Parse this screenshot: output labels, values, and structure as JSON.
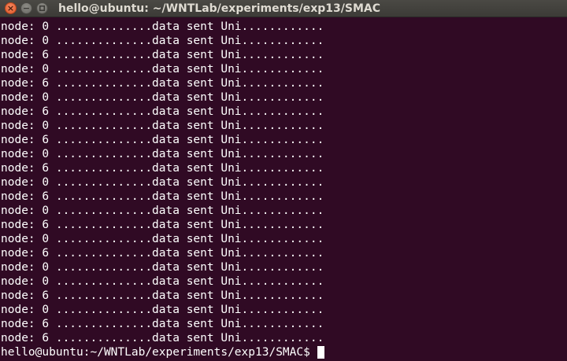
{
  "window": {
    "title": "hello@ubuntu: ~/WNTLab/experiments/exp13/SMAC",
    "buttons": {
      "close": "×",
      "minimize": "−"
    }
  },
  "terminal": {
    "lines": [
      "node: 0 ..............data sent Uni............",
      "node: 0 ..............data sent Uni............",
      "node: 6 ..............data sent Uni............",
      "node: 0 ..............data sent Uni............",
      "node: 6 ..............data sent Uni............",
      "node: 0 ..............data sent Uni............",
      "node: 6 ..............data sent Uni............",
      "node: 0 ..............data sent Uni............",
      "node: 6 ..............data sent Uni............",
      "node: 0 ..............data sent Uni............",
      "node: 6 ..............data sent Uni............",
      "node: 0 ..............data sent Uni............",
      "node: 6 ..............data sent Uni............",
      "node: 0 ..............data sent Uni............",
      "node: 6 ..............data sent Uni............",
      "node: 0 ..............data sent Uni............",
      "node: 6 ..............data sent Uni............",
      "node: 0 ..............data sent Uni............",
      "node: 0 ..............data sent Uni............",
      "node: 6 ..............data sent Uni............",
      "node: 0 ..............data sent Uni............",
      "node: 6 ..............data sent Uni............",
      "node: 6 ..............data sent Uni............"
    ],
    "prompt": "hello@ubuntu:~/WNTLab/experiments/exp13/SMAC$"
  },
  "colors": {
    "terminal_background": "#300a24",
    "terminal_text": "#ffffff",
    "titlebar_background": "#3c3b37",
    "close_button": "#e05b2b"
  },
  "icons": {
    "close": "close-icon",
    "minimize": "minimize-icon",
    "maximize": "maximize-icon"
  }
}
